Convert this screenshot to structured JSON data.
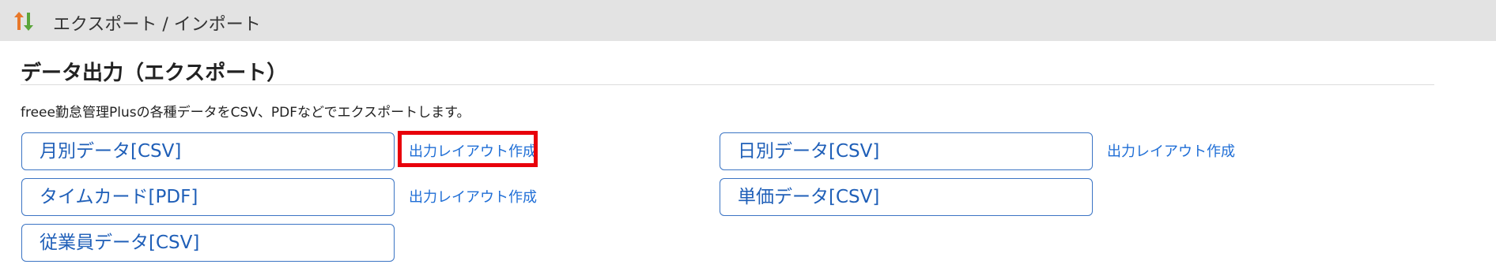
{
  "header": {
    "title": "エクスポート / インポート",
    "icon": "import-export-arrows-icon"
  },
  "section": {
    "title": "データ出力（エクスポート）",
    "description": "freee勤怠管理Plusの各種データをCSV、PDFなどでエクスポートします。"
  },
  "exports": {
    "monthly": {
      "label": "月別データ[CSV]",
      "layout_link": "出力レイアウト作成"
    },
    "timecard": {
      "label": "タイムカード[PDF]",
      "layout_link": "出力レイアウト作成"
    },
    "employee": {
      "label": "従業員データ[CSV]"
    },
    "daily": {
      "label": "日別データ[CSV]",
      "layout_link": "出力レイアウト作成"
    },
    "unit_price": {
      "label": "単価データ[CSV]"
    }
  },
  "colors": {
    "accent": "#1f6ed6",
    "highlight": "#e8000b",
    "icon_up": "#e8782a",
    "icon_down": "#5aa53a"
  }
}
